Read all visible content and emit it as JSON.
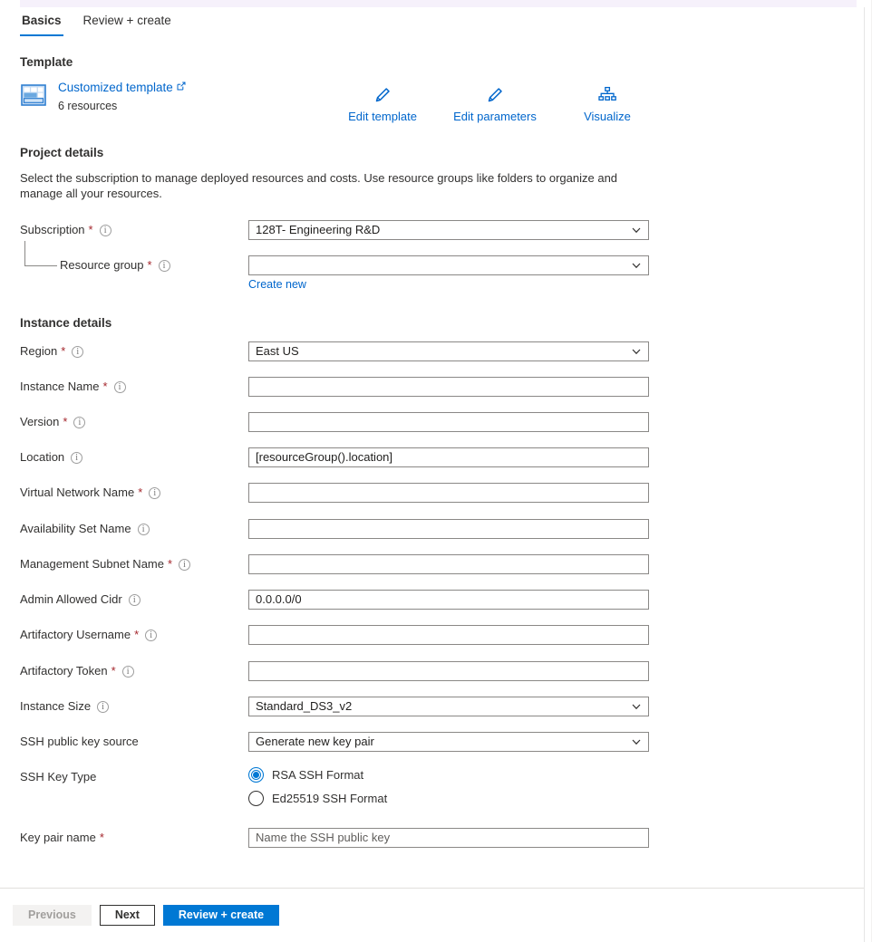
{
  "tabs": [
    {
      "label": "Basics",
      "active": true
    },
    {
      "label": "Review + create",
      "active": false
    }
  ],
  "template_section": {
    "heading": "Template",
    "link_label": "Customized template",
    "external_glyph": "↗",
    "resource_count": "6 resources",
    "actions": [
      {
        "label": "Edit template",
        "icon": "pencil-icon"
      },
      {
        "label": "Edit parameters",
        "icon": "pencil-icon"
      },
      {
        "label": "Visualize",
        "icon": "hierarchy-icon"
      }
    ]
  },
  "project_details": {
    "heading": "Project details",
    "description": "Select the subscription to manage deployed resources and costs. Use resource groups like folders to organize and manage all your resources.",
    "subscription": {
      "label": "Subscription",
      "required": "*",
      "value": "128T- Engineering R&D",
      "type": "select"
    },
    "resource_group": {
      "label": "Resource group",
      "required": "*",
      "value": "",
      "type": "select",
      "create_new_label": "Create new"
    }
  },
  "instance_details": {
    "heading": "Instance details",
    "fields": [
      {
        "label": "Region",
        "required": "*",
        "info": true,
        "type": "select",
        "value": "East US",
        "placeholder": ""
      },
      {
        "label": "Instance Name",
        "required": "*",
        "info": true,
        "type": "text",
        "value": "",
        "placeholder": ""
      },
      {
        "label": "Version",
        "required": "*",
        "info": true,
        "type": "text",
        "value": "",
        "placeholder": ""
      },
      {
        "label": "Location",
        "required": "",
        "info": true,
        "type": "text",
        "value": "[resourceGroup().location]",
        "placeholder": ""
      },
      {
        "label": "Virtual Network Name",
        "required": "*",
        "info": true,
        "type": "text",
        "value": "",
        "placeholder": ""
      },
      {
        "label": "Availability Set Name",
        "required": "",
        "info": true,
        "type": "text",
        "value": "",
        "placeholder": ""
      },
      {
        "label": "Management Subnet Name",
        "required": "*",
        "info": true,
        "type": "text",
        "value": "",
        "placeholder": ""
      },
      {
        "label": "Admin Allowed Cidr",
        "required": "",
        "info": true,
        "type": "text",
        "value": "0.0.0.0/0",
        "placeholder": ""
      },
      {
        "label": "Artifactory Username",
        "required": "*",
        "info": true,
        "type": "text",
        "value": "",
        "placeholder": ""
      },
      {
        "label": "Artifactory Token",
        "required": "*",
        "info": true,
        "type": "text",
        "value": "",
        "placeholder": ""
      },
      {
        "label": "Instance Size",
        "required": "",
        "info": true,
        "type": "select",
        "value": "Standard_DS3_v2",
        "placeholder": ""
      },
      {
        "label": "SSH public key source",
        "required": "",
        "info": false,
        "type": "select",
        "value": "Generate new key pair",
        "placeholder": ""
      }
    ],
    "ssh_key_type": {
      "label": "SSH Key Type",
      "options": [
        {
          "label": "RSA SSH Format",
          "selected": true
        },
        {
          "label": "Ed25519 SSH Format",
          "selected": false
        }
      ]
    },
    "key_pair_name": {
      "label": "Key pair name",
      "required": "*",
      "value": "",
      "placeholder": "Name the SSH public key"
    }
  },
  "footer": {
    "previous_label": "Previous",
    "next_label": "Next",
    "review_create_label": "Review + create"
  },
  "colors": {
    "accent": "#0078d4",
    "link": "#0066cc",
    "required": "#a4262c",
    "band": "#f6f1fb"
  }
}
